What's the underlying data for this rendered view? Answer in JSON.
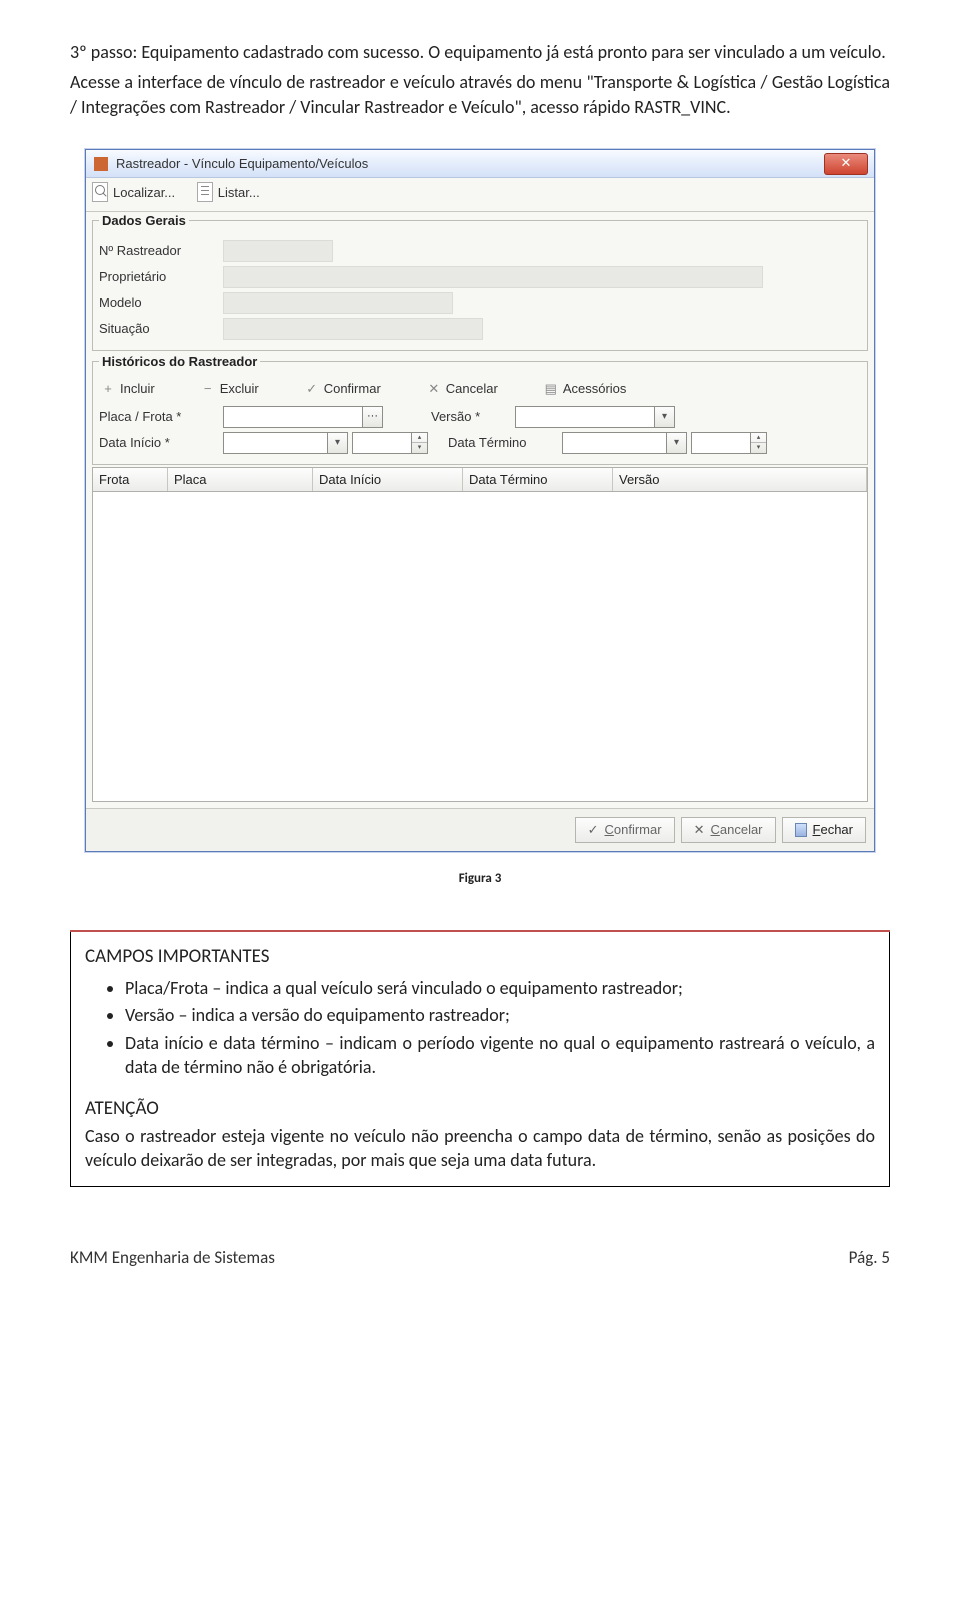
{
  "doc": {
    "step_heading": "3º passo: Equipamento cadastrado com sucesso. O equipamento já está pronto para ser vinculado a um veículo.",
    "step_text": "Acesse a interface de vínculo de rastreador e veículo através do menu \"Transporte & Logística / Gestão Logística / Integrações com Rastreador / Vincular Rastreador e Veículo\", acesso rápido RASTR_VINC.",
    "caption": "Figura 3",
    "box_title": "CAMPOS IMPORTANTES",
    "bullet1": "Placa/Frota – indica a qual veículo será vinculado o equipamento rastreador;",
    "bullet2": "Versão – indica a versão do equipamento rastreador;",
    "bullet3": "Data início e data término – indicam o período vigente no qual o equipamento rastreará o veículo, a data de término não é obrigatória.",
    "atencao_title": "ATENÇÃO",
    "atencao_text": "Caso o rastreador esteja vigente no veículo não preencha o campo data de término, senão as posições do veículo deixarão de ser integradas, por mais que seja uma data futura.",
    "footer_left": "KMM Engenharia de Sistemas",
    "footer_right": "Pág. 5"
  },
  "win": {
    "title": "Rastreador - Vínculo Equipamento/Veículos",
    "tb_localizar": "Localizar...",
    "tb_listar": "Listar...",
    "legend_geral": "Dados Gerais",
    "lbl_num": "Nº Rastreador",
    "lbl_prop": "Proprietário",
    "lbl_modelo": "Modelo",
    "lbl_sit": "Situação",
    "legend_hist": "Históricos do Rastreador",
    "act_incluir": "Incluir",
    "act_excluir": "Excluir",
    "act_confirmar": "Confirmar",
    "act_cancelar": "Cancelar",
    "act_acess": "Acessórios",
    "lbl_placa": "Placa / Frota *",
    "lbl_versao": "Versão *",
    "lbl_dini": "Data Início *",
    "lbl_dfim": "Data Término",
    "gh1": "Frota",
    "gh2": "Placa",
    "gh3": "Data Início",
    "gh4": "Data Término",
    "gh5": "Versão",
    "btn_confirm": "Confirmar",
    "btn_cancel": "Cancelar",
    "btn_close": "Fechar"
  }
}
